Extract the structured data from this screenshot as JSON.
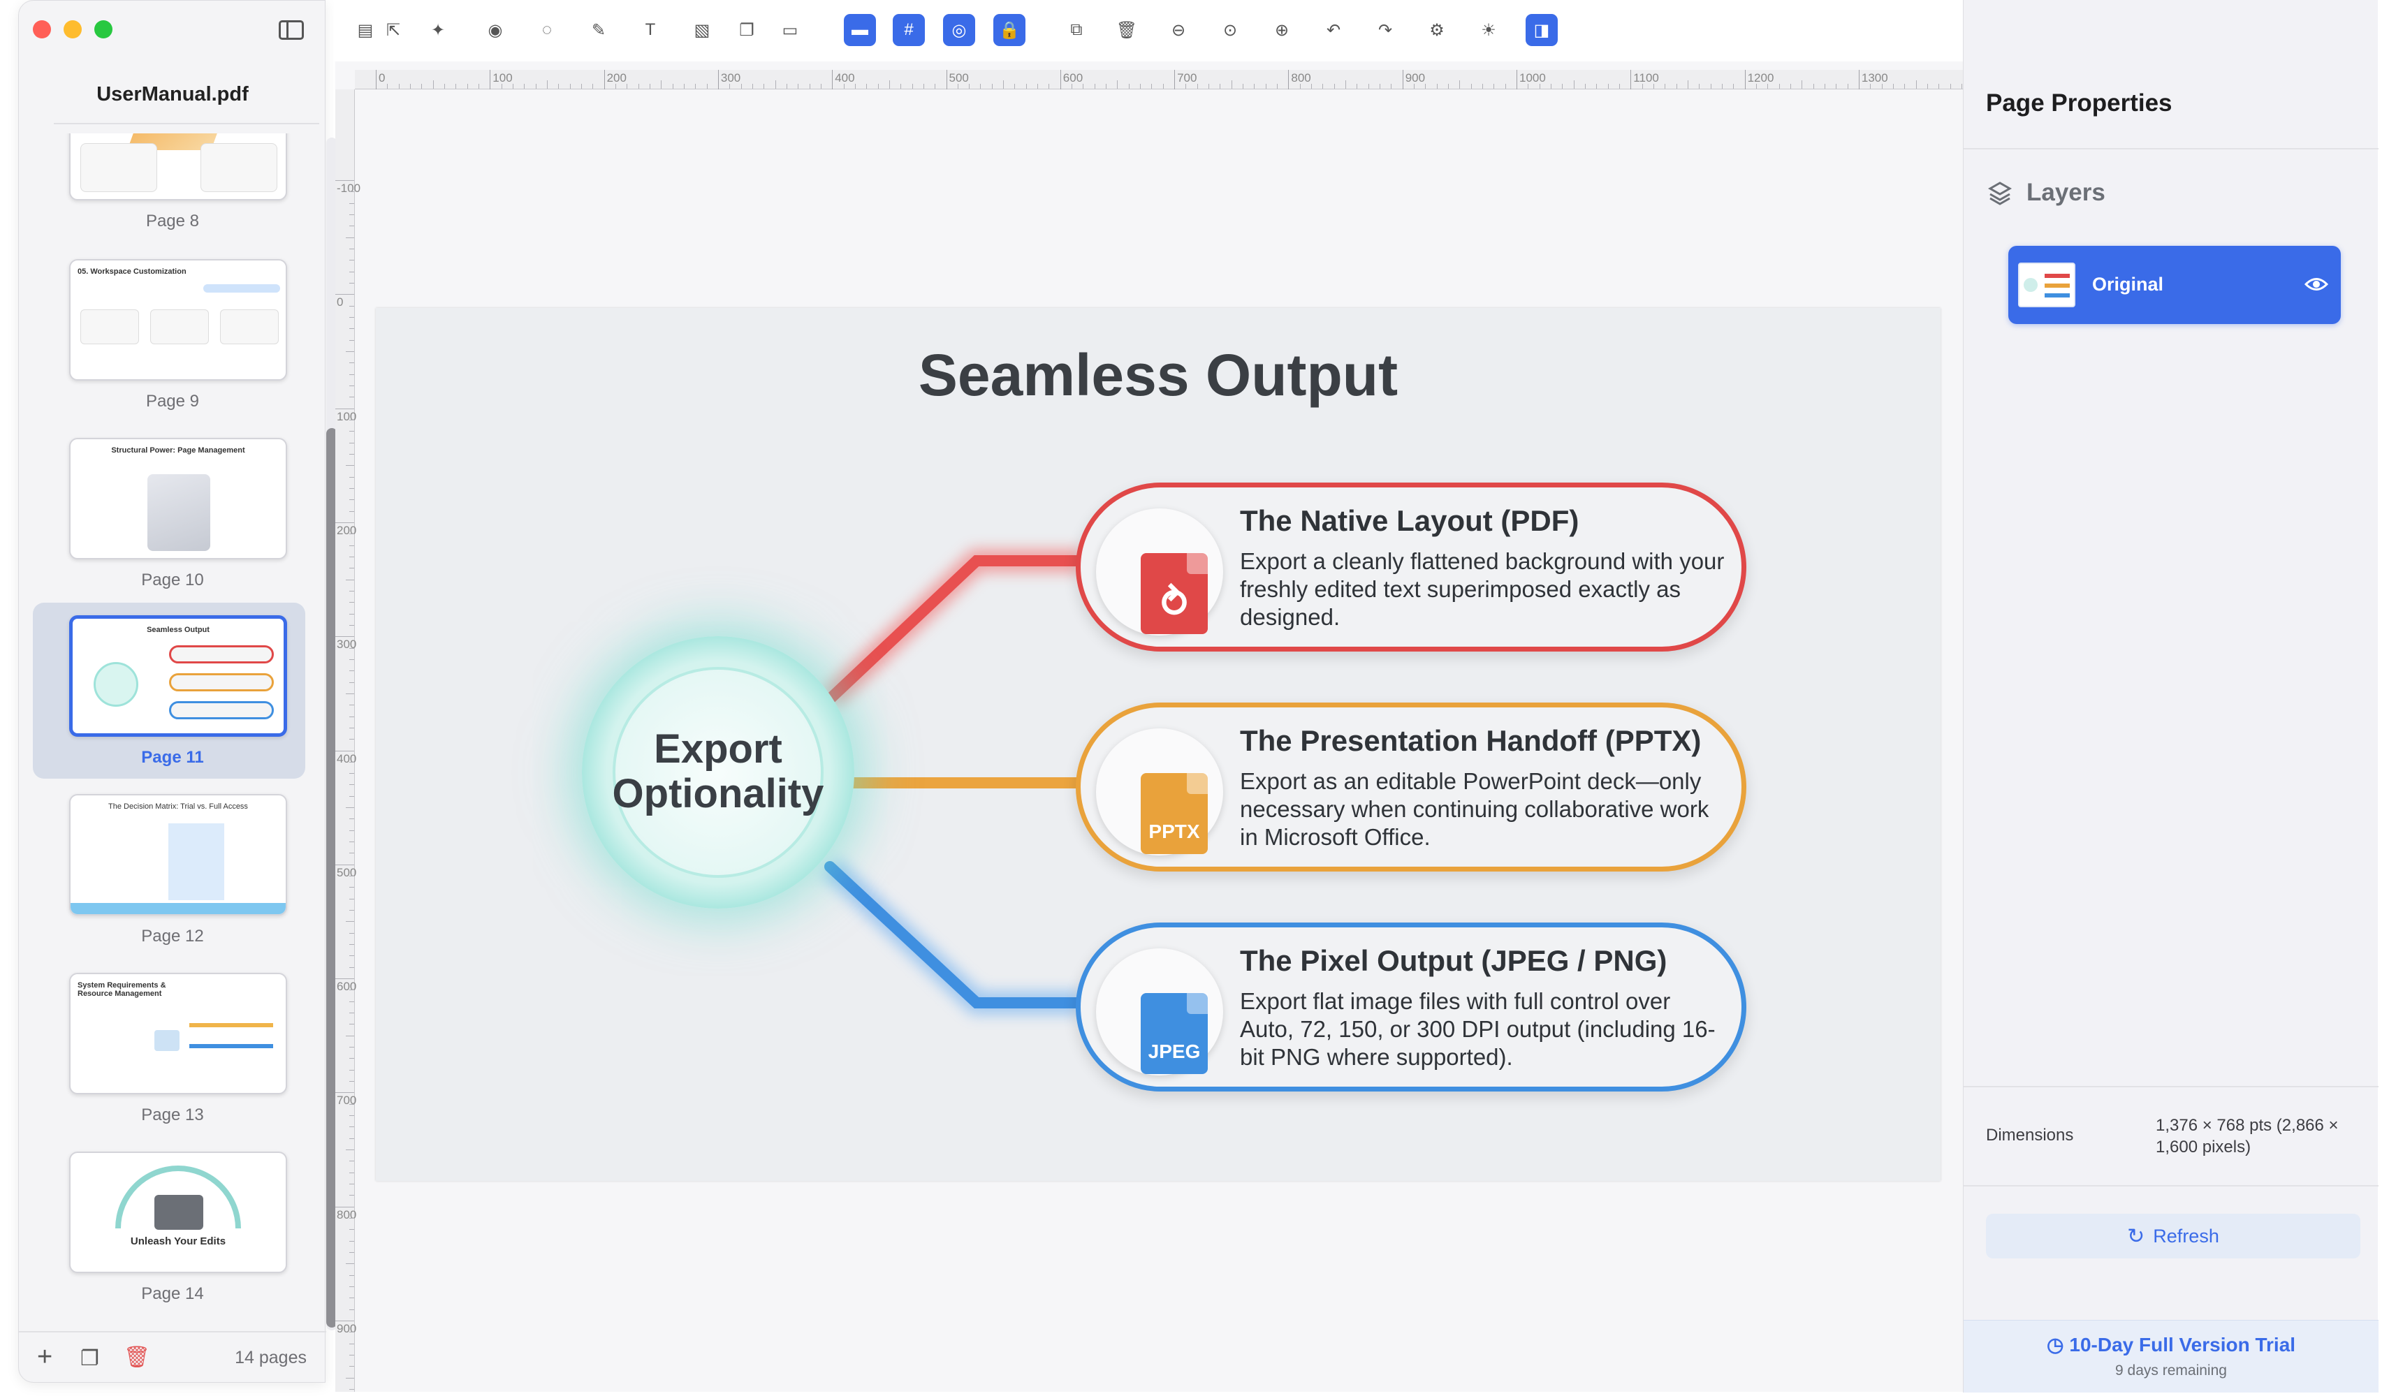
{
  "window": {
    "traffic_lights": [
      "#ff5f57",
      "#febc2e",
      "#28c840"
    ]
  },
  "sidebar": {
    "doc_title": "UserManual.pdf",
    "pages_count": "14 pages",
    "thumbnails": [
      {
        "label": "Page 8",
        "title": ""
      },
      {
        "label": "Page 9",
        "title": "05. Workspace Customization"
      },
      {
        "label": "Page 10",
        "title": "Structural Power: Page Management"
      },
      {
        "label": "Page 11",
        "title": "Seamless Output",
        "selected": true
      },
      {
        "label": "Page 12",
        "title": "The Decision Matrix: Trial vs. Full Access"
      },
      {
        "label": "Page 13",
        "title": "System Requirements & Resource Management"
      },
      {
        "label": "Page 14",
        "title": "Unleash Your Edits"
      }
    ]
  },
  "toolbar": {
    "buttons": [
      {
        "name": "stack",
        "glyph": "▤",
        "active": false
      },
      {
        "name": "export",
        "glyph": "⇱",
        "active": false
      },
      {
        "name": "magic-wand",
        "glyph": "✦",
        "active": false
      },
      {
        "name": "eye",
        "glyph": "◉",
        "active": false
      },
      {
        "name": "lasso",
        "glyph": "◌",
        "active": false
      },
      {
        "name": "pen",
        "glyph": "✎",
        "active": false
      },
      {
        "name": "text-box",
        "glyph": "T",
        "active": false
      },
      {
        "name": "add-image",
        "glyph": "▧",
        "active": false
      },
      {
        "name": "copy",
        "glyph": "❐",
        "active": false
      },
      {
        "name": "paste",
        "glyph": "▭",
        "active": false
      },
      {
        "name": "ruler",
        "glyph": "▬",
        "active": true
      },
      {
        "name": "grid",
        "glyph": "#",
        "active": true
      },
      {
        "name": "target",
        "glyph": "◎",
        "active": true
      },
      {
        "name": "lock",
        "glyph": "🔒",
        "active": true
      },
      {
        "name": "duplicate",
        "glyph": "⧉",
        "active": false
      },
      {
        "name": "trash",
        "glyph": "🗑",
        "active": false
      },
      {
        "name": "zoom-out",
        "glyph": "⊖",
        "active": false
      },
      {
        "name": "zoom-fit",
        "glyph": "⊙",
        "active": false
      },
      {
        "name": "zoom-in",
        "glyph": "⊕",
        "active": false
      },
      {
        "name": "undo",
        "glyph": "↶",
        "active": false
      },
      {
        "name": "redo",
        "glyph": "↷",
        "active": false
      },
      {
        "name": "settings",
        "glyph": "⚙",
        "active": false
      },
      {
        "name": "brightness",
        "glyph": "☀",
        "active": false
      },
      {
        "name": "panel-toggle",
        "glyph": "◨",
        "active": true
      }
    ]
  },
  "rulers": {
    "horizontal": [
      "0",
      "100",
      "200",
      "300",
      "400",
      "500",
      "600",
      "700",
      "800",
      "900",
      "1000",
      "1100",
      "1200",
      "1300"
    ],
    "vertical": [
      "-100",
      "0",
      "100",
      "200",
      "300",
      "400",
      "500",
      "600",
      "700",
      "800",
      "900"
    ]
  },
  "slide": {
    "title": "Seamless Output",
    "hub": "Export Optionality",
    "items": [
      {
        "title": "The Native Layout (PDF)",
        "desc": "Export a cleanly flattened background with your freshly edited text superimposed exactly as designed.",
        "icon_text": "",
        "color": "#e04848"
      },
      {
        "title": "The Presentation Handoff (PPTX)",
        "desc": "Export as an editable PowerPoint deck—only necessary when continuing collaborative work in Microsoft Office.",
        "icon_text": "PPTX",
        "color": "#e9a23b"
      },
      {
        "title": "The Pixel Output (JPEG / PNG)",
        "desc": "Export flat image files with full control over Auto, 72, 150, or 300 DPI output (including 16-bit PNG where supported).",
        "icon_text": "JPEG",
        "color": "#3f8fe0"
      }
    ]
  },
  "panel": {
    "title": "Page Properties",
    "layers_label": "Layers",
    "layer_name": "Original",
    "dimensions_label": "Dimensions",
    "dimensions_value": "1,376 × 768 pts (2,866 × 1,600 pixels)",
    "refresh_label": "Refresh",
    "trial_title": "10-Day Full Version Trial",
    "trial_sub": "9 days remaining"
  },
  "colors": {
    "accent": "#3a6be8"
  }
}
